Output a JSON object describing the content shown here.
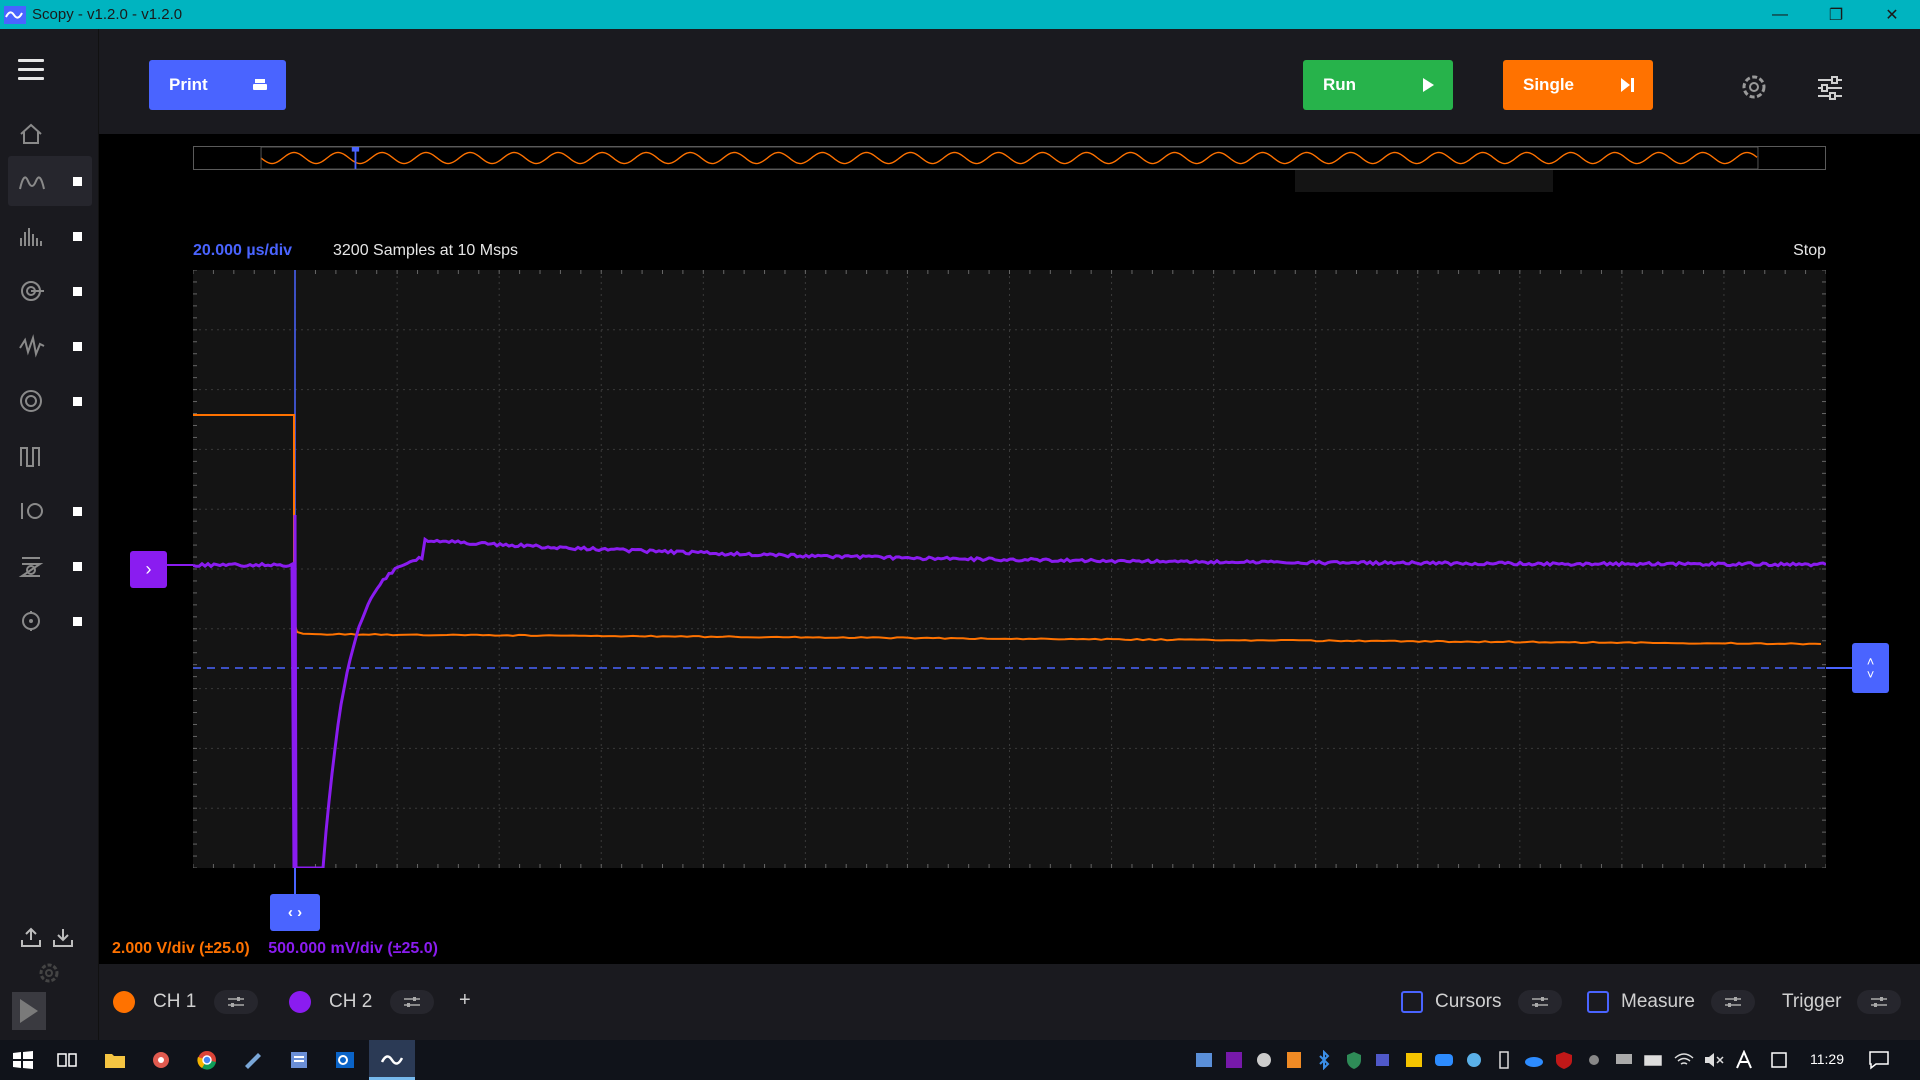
{
  "window": {
    "title": "Scopy - v1.2.0 - v1.2.0",
    "controls": [
      "minimize",
      "restore",
      "close"
    ]
  },
  "sidebar": {
    "items": [
      {
        "icon": "home-icon",
        "active": false
      },
      {
        "icon": "oscilloscope-icon",
        "active": true
      },
      {
        "icon": "spectrum-analyzer-icon",
        "active": false
      },
      {
        "icon": "network-analyzer-icon",
        "active": false
      },
      {
        "icon": "signal-generator-icon",
        "active": false
      },
      {
        "icon": "voltmeter-icon",
        "active": false
      },
      {
        "icon": "power-supply-icon",
        "active": false
      },
      {
        "icon": "logic-analyzer-icon",
        "active": false
      },
      {
        "icon": "pattern-generator-icon",
        "active": false
      },
      {
        "icon": "digital-io-icon",
        "active": false
      }
    ]
  },
  "toolbar": {
    "print_label": "Print",
    "run_label": "Run",
    "single_label": "Single"
  },
  "plot": {
    "time_div": "20.000 µs/div",
    "samples": "3200 Samples at 10 Msps",
    "status": "Stop",
    "ch1_scale": "2.000 V/div (±25.0)",
    "ch2_scale": "500.000 mV/div (±25.0)"
  },
  "channels": [
    {
      "label": "CH 1",
      "color": "#ff7200"
    },
    {
      "label": "CH 2",
      "color": "#8a1cf0"
    }
  ],
  "bottom": {
    "add_label": "+",
    "cursors_label": "Cursors",
    "measure_label": "Measure",
    "trigger_label": "Trigger"
  },
  "taskbar": {
    "clock": "11:29"
  },
  "colors": {
    "accent": "#4a64ff",
    "run": "#27b34b",
    "single": "#ff7200",
    "ch1": "#ff7200",
    "ch2": "#8a1cf0",
    "titlebar": "#00b4c0"
  }
}
